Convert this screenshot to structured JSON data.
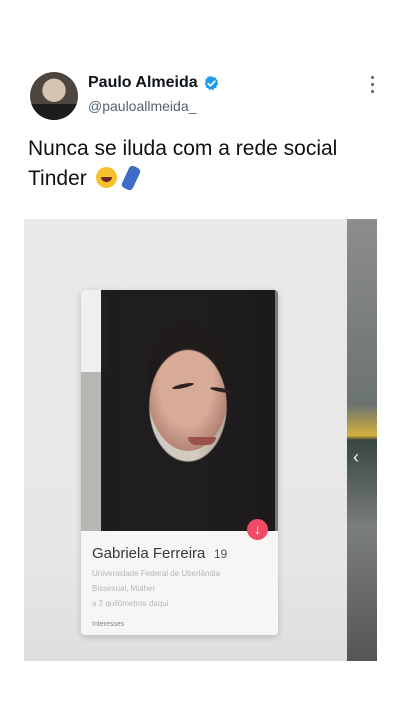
{
  "author": {
    "name": "Paulo Almeida",
    "handle": "@pauloallmeida_"
  },
  "tweet": {
    "text": "Nunca se iluda com a rede social Tinder"
  },
  "profile": {
    "name": "Gabriela Ferreira",
    "age": "19",
    "lines": [
      "Universidade Federal de Uberlândia",
      "Bissexual, Mulher",
      "a 2 quilômetros daqui"
    ],
    "interests_label": "Interesses"
  },
  "icons": {
    "verified": "verified-badge-icon",
    "more": "more-options-icon",
    "like": "arrow-down-icon"
  },
  "colors": {
    "verified": "#1d9bf0",
    "tinder_pink": "#f04b66"
  }
}
